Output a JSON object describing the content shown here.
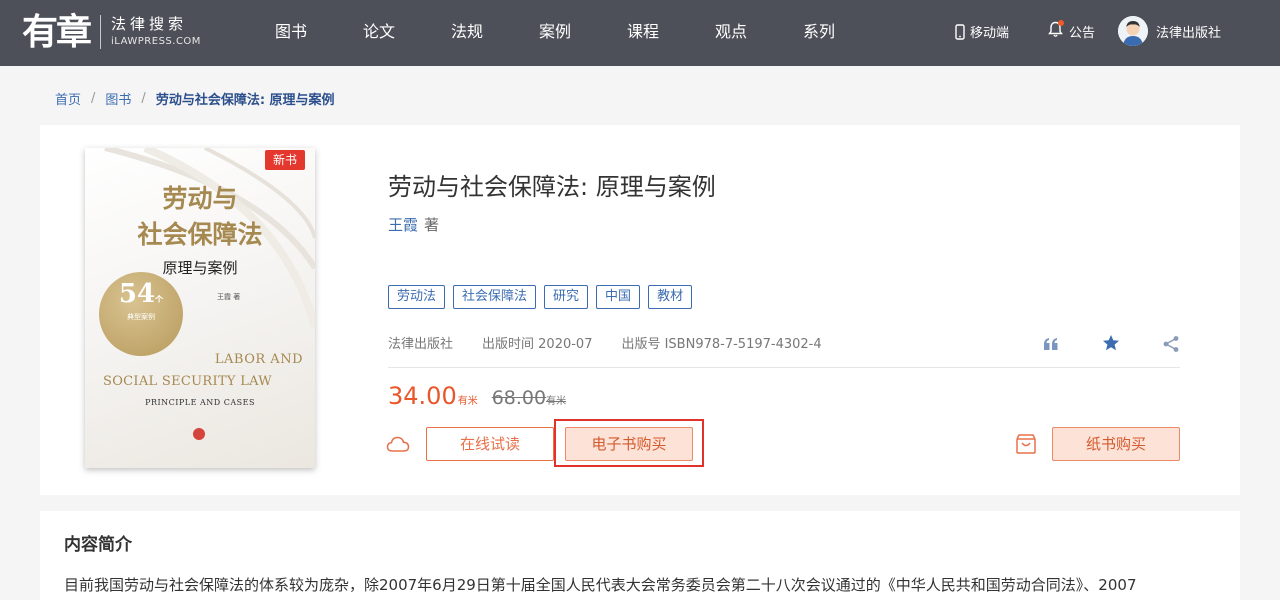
{
  "header": {
    "logo": {
      "main": "有章",
      "sub": "法律搜索",
      "en": "iLAWPRESS.COM"
    },
    "nav": [
      "图书",
      "论文",
      "法规",
      "案例",
      "课程",
      "观点",
      "系列"
    ],
    "mobile_label": "移动端",
    "notice_label": "公告",
    "user_name": "法律出版社"
  },
  "breadcrumb": {
    "home": "首页",
    "books": "图书",
    "current": "劳动与社会保障法: 原理与案例"
  },
  "book": {
    "cover": {
      "badge": "新书",
      "title_line1": "劳动与",
      "title_line2": "社会保障法",
      "subtitle": "原理与案例",
      "circle_num": "54",
      "circle_unit": "个",
      "circle_label": "典型案例",
      "author": "王霞 著",
      "en_line1": "LABOR AND",
      "en_line2": "SOCIAL SECURITY LAW",
      "en_line3": "PRINCIPLE AND CASES"
    },
    "title": "劳动与社会保障法: 原理与案例",
    "author": "王霞",
    "author_role": "著",
    "tags": [
      "劳动法",
      "社会保障法",
      "研究",
      "中国",
      "教材"
    ],
    "publisher": "法律出版社",
    "pub_date": "出版时间 2020-07",
    "isbn": "出版号 ISBN978-7-5197-4302-4",
    "price": "34.00",
    "price_unit": "有米",
    "original_price": "68.00",
    "original_unit": "有米",
    "buttons": {
      "read_online": "在线试读",
      "ebook_buy": "电子书购买",
      "paper_buy": "纸书购买"
    }
  },
  "intro": {
    "title": "内容简介",
    "text": "目前我国劳动与社会保障法的体系较为庞杂，除2007年6月29日第十届全国人民代表大会常务委员会第二十八次会议通过的《中华人民共和国劳动合同法》、2007"
  },
  "colors": {
    "header_bg": "#4d5059",
    "accent": "#e8562a",
    "link": "#3c6db0",
    "highlight": "#e0332b"
  }
}
